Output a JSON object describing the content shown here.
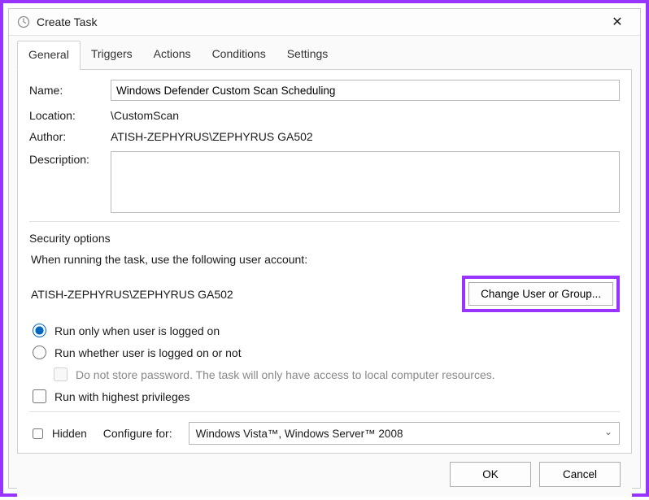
{
  "window": {
    "title": "Create Task",
    "close_icon": "✕"
  },
  "tabs": [
    "General",
    "Triggers",
    "Actions",
    "Conditions",
    "Settings"
  ],
  "form": {
    "name_label": "Name:",
    "name_value": "Windows Defender Custom Scan Scheduling",
    "location_label": "Location:",
    "location_value": "\\CustomScan",
    "author_label": "Author:",
    "author_value": "ATISH-ZEPHYRUS\\ZEPHYRUS GA502",
    "description_label": "Description:",
    "description_value": ""
  },
  "security": {
    "group_label": "Security options",
    "when_running": "When running the task, use the following user account:",
    "account": "ATISH-ZEPHYRUS\\ZEPHYRUS GA502",
    "change_btn": "Change User or Group...",
    "radio_logged_on": "Run only when user is logged on",
    "radio_not_logged": "Run whether user is logged on or not",
    "no_store_pw": "Do not store password.  The task will only have access to local computer resources.",
    "highest_priv": "Run with highest privileges"
  },
  "bottom": {
    "hidden": "Hidden",
    "configure_for": "Configure for:",
    "configure_value": "Windows Vista™, Windows Server™ 2008"
  },
  "footer": {
    "ok": "OK",
    "cancel": "Cancel"
  }
}
